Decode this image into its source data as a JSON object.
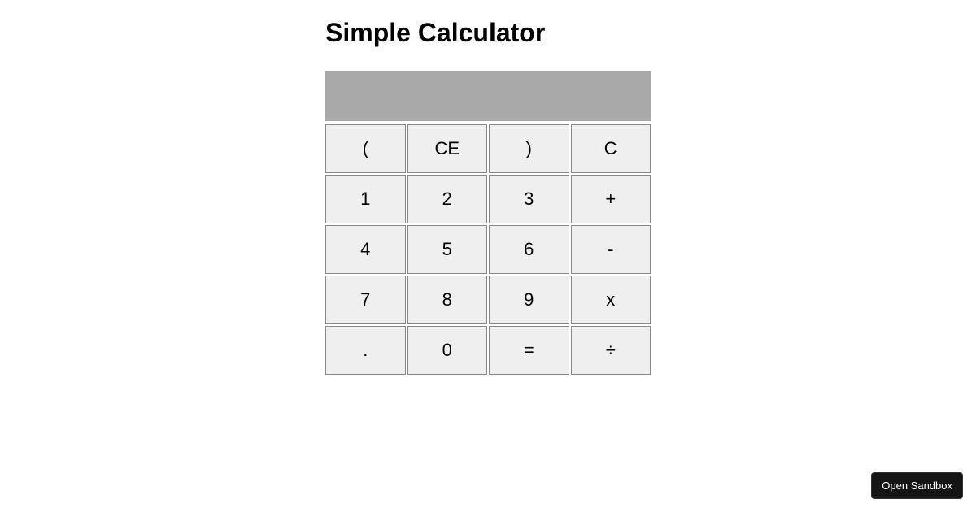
{
  "title": "Simple Calculator",
  "display": {
    "value": "",
    "placeholder": ""
  },
  "keys": {
    "r0c0": "(",
    "r0c1": "CE",
    "r0c2": ")",
    "r0c3": "C",
    "r1c0": "1",
    "r1c1": "2",
    "r1c2": "3",
    "r1c3": "+",
    "r2c0": "4",
    "r2c1": "5",
    "r2c2": "6",
    "r2c3": "-",
    "r3c0": "7",
    "r3c1": "8",
    "r3c2": "9",
    "r3c3": "x",
    "r4c0": ".",
    "r4c1": "0",
    "r4c2": "=",
    "r4c3": "÷"
  },
  "sandbox": {
    "label": "Open Sandbox"
  }
}
